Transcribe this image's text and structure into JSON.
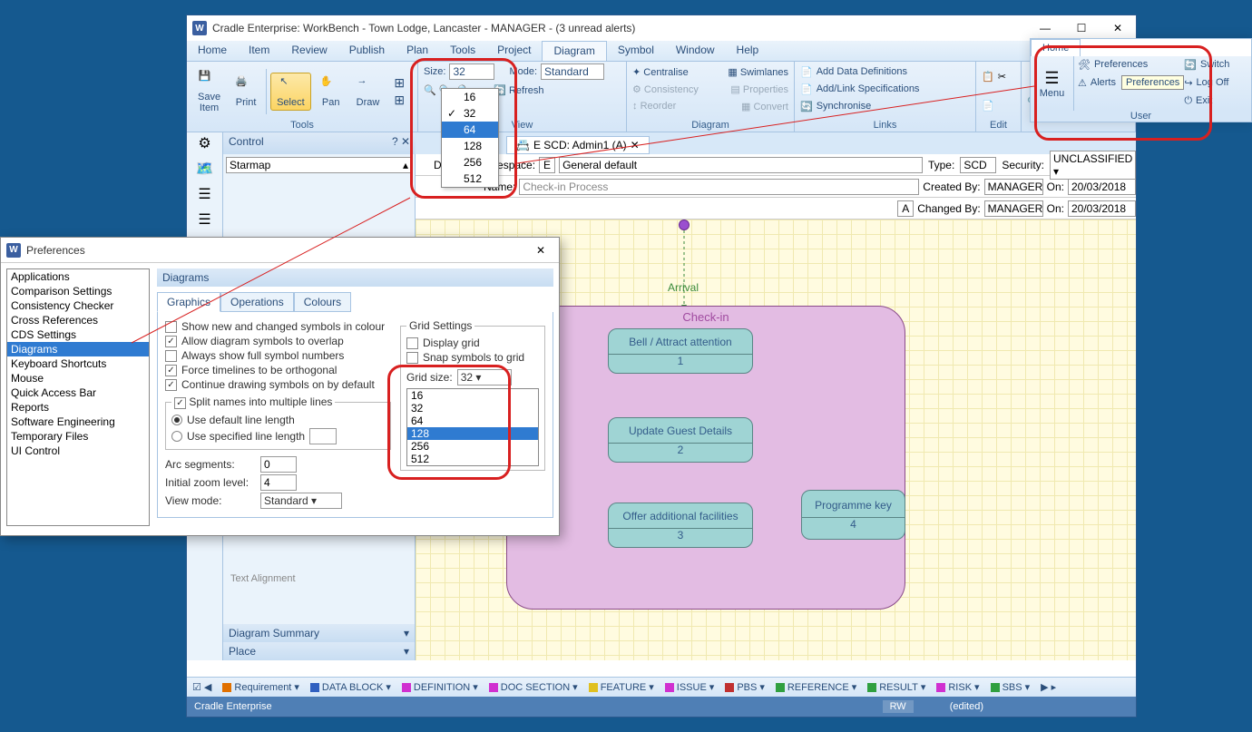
{
  "window": {
    "title": "Cradle Enterprise: WorkBench - Town Lodge, Lancaster - MANAGER - (3 unread alerts)"
  },
  "menu": [
    "Home",
    "Item",
    "Review",
    "Publish",
    "Plan",
    "Tools",
    "Project",
    "Diagram",
    "Symbol",
    "Window",
    "Help"
  ],
  "active_menu": "Diagram",
  "ribbon": {
    "save": "Save\nItem",
    "print": "Print",
    "select": "Select",
    "pan": "Pan",
    "draw": "Draw",
    "tools_label": "Tools",
    "size_lbl": "Size:",
    "size_val": "32",
    "size_options": [
      "16",
      "32",
      "64",
      "128",
      "256",
      "512"
    ],
    "size_selected": "64",
    "size_checked": "32",
    "mode_lbl": "Mode:",
    "mode_val": "Standard",
    "refresh": "Refresh",
    "view_label": "View",
    "centralise": "Centralise",
    "swimlanes": "Swimlanes",
    "consistency": "Consistency",
    "properties": "Properties",
    "reorder": "Reorder",
    "convert": "Convert",
    "diagram_label": "Diagram",
    "add_data": "Add Data Definitions",
    "add_link": "Add/Link Specifications",
    "sync": "Synchronise",
    "links_label": "Links",
    "edit_label": "Edit"
  },
  "control": {
    "hdr": "Control",
    "starmap": "Starmap"
  },
  "doc_tab": "E SCD: Admin1 (A)",
  "props": {
    "domain_lbl": "Domain/Namespace:",
    "domain_v": "E",
    "namespace": "General default",
    "name_lbl": "Name:",
    "name_v": "Check-in Process",
    "type_lbl": "Type:",
    "type_v": "SCD",
    "sec_lbl": "Security:",
    "sec_v": "UNCLASSIFIED",
    "created_lbl": "Created By:",
    "created_by": "MANAGER",
    "created_on": "20/03/2018",
    "changed_lbl": "Changed By:",
    "changed_by": "MANAGER",
    "changed_on": "20/03/2018",
    "on_lbl": "On:",
    "a_badge": "A"
  },
  "diag": {
    "arrival": "Arrival",
    "container": "Check-in",
    "b1": {
      "t": "Bell / Attract attention",
      "n": "1"
    },
    "b2": {
      "t": "Update Guest Details",
      "n": "2"
    },
    "b3": {
      "t": "Offer additional facilities",
      "n": "3"
    },
    "b4": {
      "t": "Programme key",
      "n": "4"
    }
  },
  "sidepanel": {
    "textalign": "Text Alignment",
    "summary": "Diagram Summary",
    "place": "Place"
  },
  "bottom": [
    "Requirement",
    "DATA BLOCK",
    "DEFINITION",
    "DOC SECTION",
    "FEATURE",
    "ISSUE",
    "PBS",
    "REFERENCE",
    "RESULT",
    "RISK",
    "SBS"
  ],
  "bottom_colors": [
    "#e07000",
    "#3060c0",
    "#d030d0",
    "#d030d0",
    "#e0c020",
    "#d030d0",
    "#c03030",
    "#30a040",
    "#30a040",
    "#d030d0",
    "#30a040"
  ],
  "status": {
    "app": "Cradle Enterprise",
    "rw": "RW",
    "edited": "(edited)"
  },
  "pref": {
    "title": "Preferences",
    "cats": [
      "Applications",
      "Comparison Settings",
      "Consistency Checker",
      "Cross References",
      "CDS Settings",
      "Diagrams",
      "Keyboard Shortcuts",
      "Mouse",
      "Quick Access Bar",
      "Reports",
      "Software Engineering",
      "Temporary Files",
      "UI Control"
    ],
    "cat_sel": "Diagrams",
    "section": "Diagrams",
    "tabs": [
      "Graphics",
      "Operations",
      "Colours"
    ],
    "opts": {
      "new_changed": "Show new and changed symbols in colour",
      "overlap": "Allow diagram symbols to overlap",
      "full_numbers": "Always show full symbol numbers",
      "timelines": "Force timelines to be orthogonal",
      "continue": "Continue drawing symbols on by default"
    },
    "split_grp": "Split names into multiple lines",
    "use_default": "Use default line length",
    "use_spec": "Use specified line length",
    "arc": "Arc segments:",
    "arc_v": "0",
    "zoom": "Initial zoom level:",
    "zoom_v": "4",
    "view": "View mode:",
    "view_v": "Standard",
    "grid_legend": "Grid Settings",
    "display_grid": "Display grid",
    "snap": "Snap symbols to grid",
    "gridsize": "Grid size:",
    "gridsize_v": "32",
    "grid_opts": [
      "16",
      "32",
      "64",
      "128",
      "256",
      "512"
    ],
    "grid_sel": "128"
  },
  "userpanel": {
    "home": "Home",
    "menu": "Menu",
    "prefs": "Preferences",
    "switch": "Switch",
    "alerts": "Alerts",
    "logoff": "Log Off",
    "exit": "Exit",
    "tooltip": "Preferences",
    "label": "User"
  }
}
